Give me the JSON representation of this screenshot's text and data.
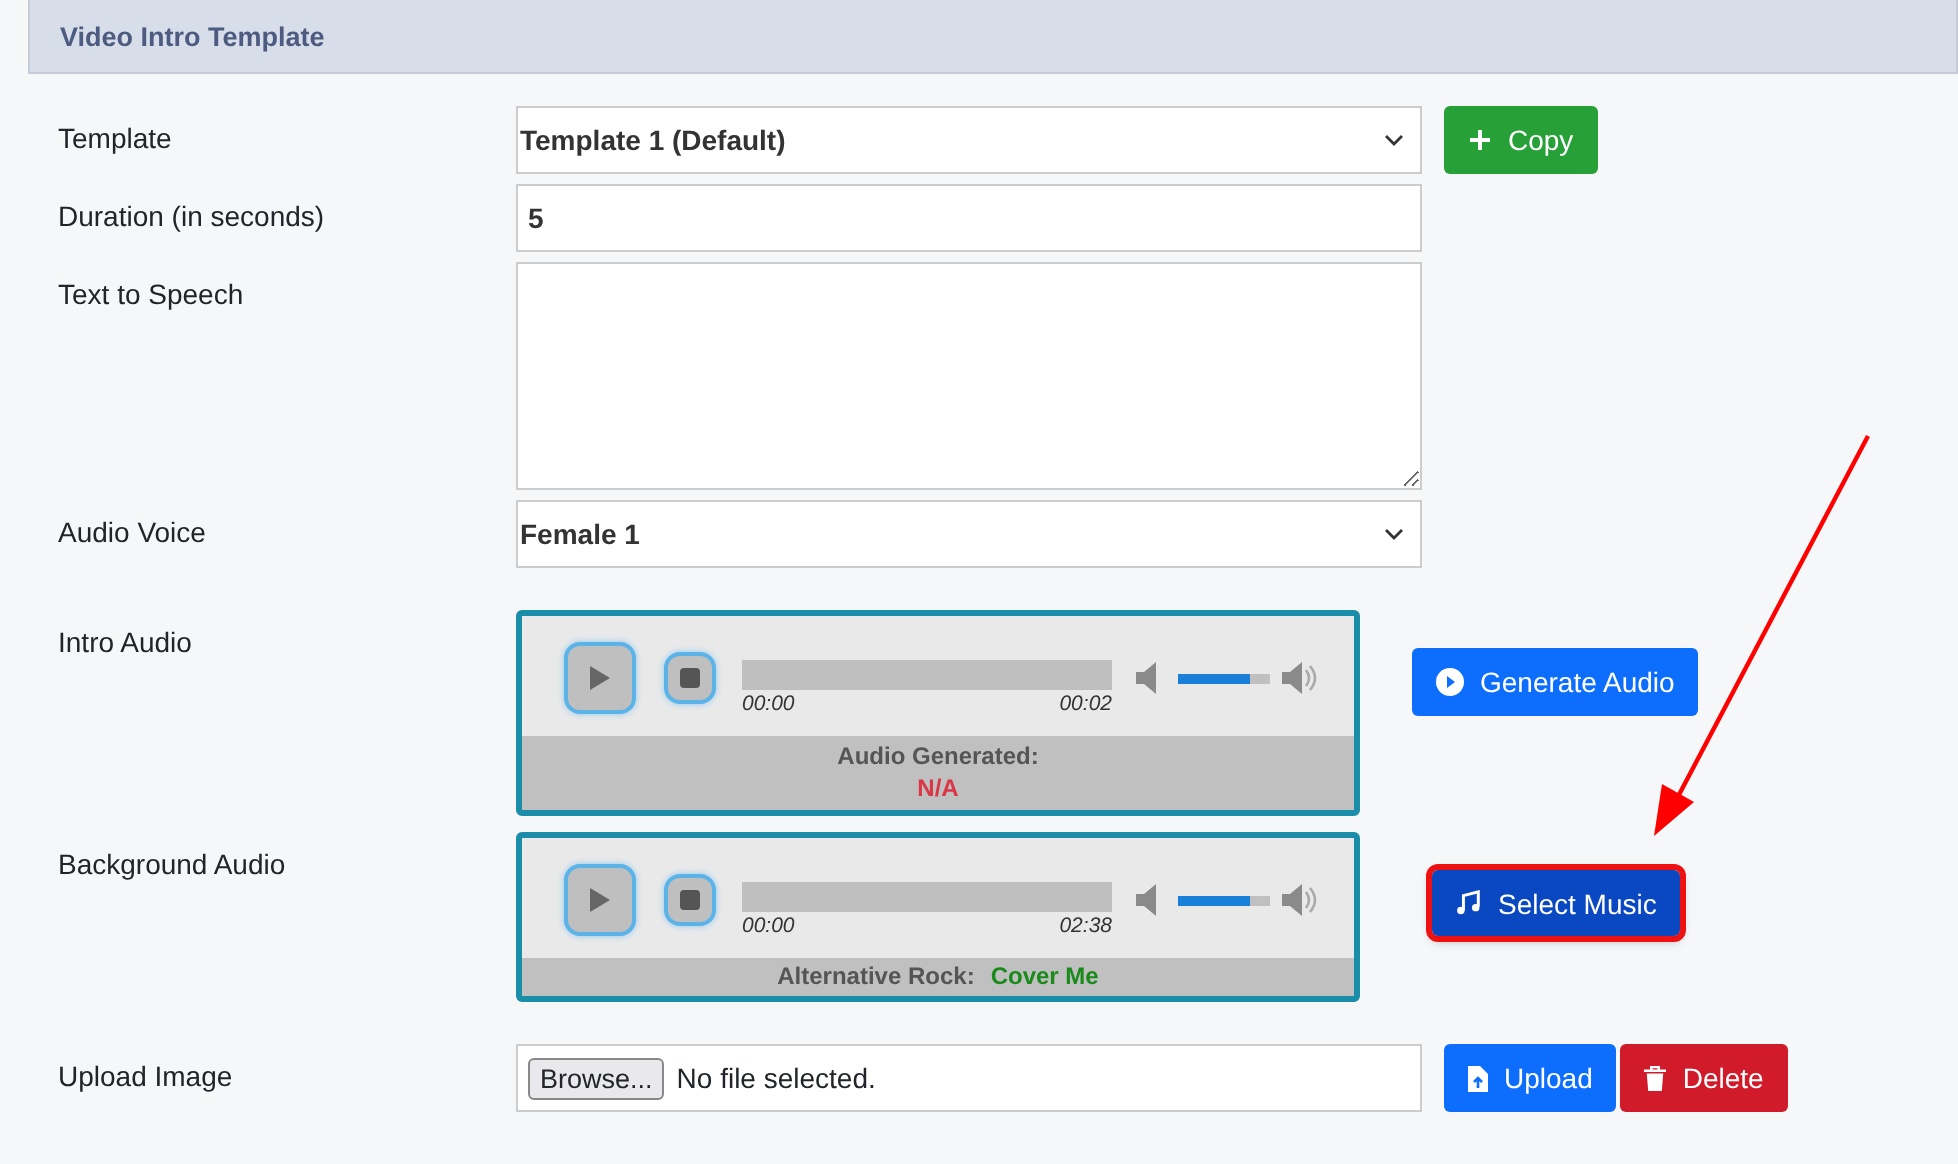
{
  "panel": {
    "title": "Video Intro Template"
  },
  "template": {
    "label": "Template",
    "value": "Template 1 (Default)",
    "button": {
      "label": "Copy",
      "kind": "success",
      "highlighted": false
    }
  },
  "duration": {
    "label": "Duration (in seconds)",
    "value": "5"
  },
  "text_to_speech": {
    "label": "Text to Speech"
  },
  "audio_voice": {
    "label": "Audio Voice",
    "value": "Female 1"
  },
  "intro_audio": {
    "label": "Intro Audio",
    "player": {
      "kind": "stacked",
      "progress": {
        "level": 0
      },
      "start_time": "00:00",
      "end_time": "00:02",
      "volume": {
        "level": 0.78
      },
      "caption": "Audio Generated:",
      "caption_value": "N/A",
      "color": "#dc3545"
    },
    "button": {
      "label": "Generate Audio",
      "kind": "primary",
      "highlighted": false
    }
  },
  "background_audio": {
    "label": "Background Audio",
    "player": {
      "kind": "inline",
      "progress": {
        "level": 0
      },
      "start_time": "00:00",
      "end_time": "02:38",
      "volume": {
        "level": 0.78
      },
      "caption": "Alternative Rock:",
      "caption_value": "Cover Me",
      "color": "#1a8a1a"
    },
    "button": {
      "label": "Select Music",
      "kind": "dark",
      "highlighted": true
    }
  },
  "upload_image": {
    "label": "Upload Image",
    "browse": "Browse...",
    "file_status": "No file selected.",
    "buttons": [
      {
        "label": "Upload",
        "kind": "primary"
      },
      {
        "label": "Delete",
        "kind": "danger"
      }
    ]
  }
}
